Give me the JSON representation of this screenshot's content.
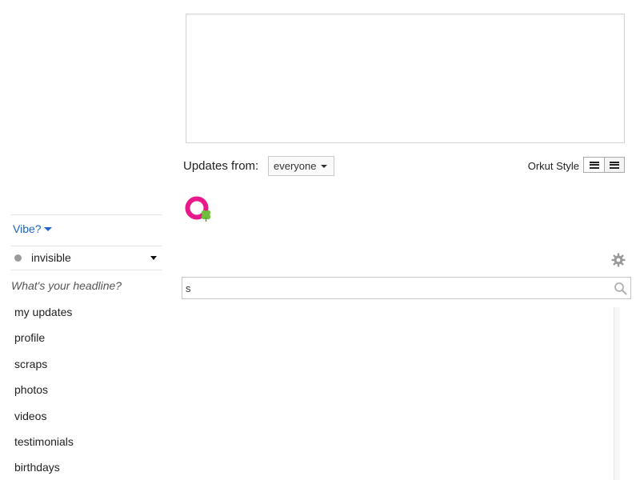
{
  "composer": {
    "placeholder": ""
  },
  "updates": {
    "label": "Updates from:",
    "filter_value": "everyone",
    "style_label": "Orkut Style"
  },
  "search": {
    "value": "s",
    "icon": "search-icon"
  },
  "sidebar": {
    "vibe_label": "Vibe?",
    "status_label": "invisible",
    "headline_placeholder": "What's your headline?",
    "items": [
      {
        "label": "my updates"
      },
      {
        "label": "profile"
      },
      {
        "label": "scraps"
      },
      {
        "label": "photos"
      },
      {
        "label": "videos"
      },
      {
        "label": "testimonials"
      },
      {
        "label": "birthdays"
      }
    ]
  },
  "colors": {
    "link": "#1a66c2",
    "logo_pink": "#e8198b",
    "logo_green": "#6fbf3c"
  }
}
